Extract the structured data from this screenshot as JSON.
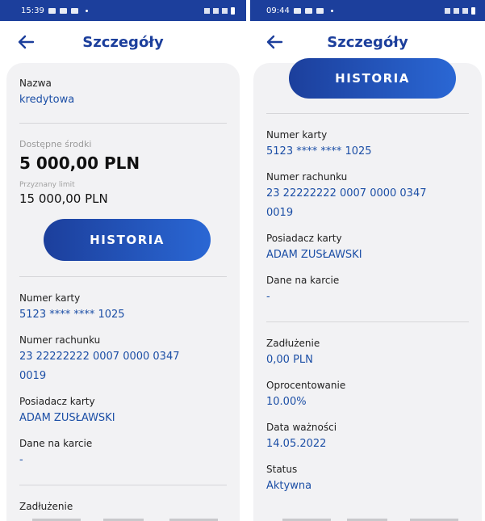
{
  "left": {
    "status": {
      "time": "15:39"
    },
    "header": {
      "title": "Szczegóły"
    },
    "nazwa": {
      "label": "Nazwa",
      "value": "kredytowa"
    },
    "dostepne": {
      "label": "Dostępne środki",
      "value": "5 000,00 PLN"
    },
    "limit": {
      "label": "Przyznany limit",
      "value": "15 000,00 PLN"
    },
    "historia_label": "HISTORIA",
    "numer_karty": {
      "label": "Numer karty",
      "value": "5123 **** **** 1025"
    },
    "numer_rachunku": {
      "label": "Numer rachunku",
      "value_line1": "23 22222222 0007 0000 0347",
      "value_line2": "0019"
    },
    "posiadacz": {
      "label": "Posiadacz karty",
      "value": "ADAM ZUSŁAWSKI"
    },
    "dane": {
      "label": "Dane na karcie",
      "value": "-"
    },
    "zadluzenie": {
      "label": "Zadłużenie"
    }
  },
  "right": {
    "status": {
      "time": "09:44"
    },
    "header": {
      "title": "Szczegóły"
    },
    "historia_label": "HISTORIA",
    "numer_karty": {
      "label": "Numer karty",
      "value": "5123 **** **** 1025"
    },
    "numer_rachunku": {
      "label": "Numer rachunku",
      "value_line1": "23 22222222 0007 0000 0347",
      "value_line2": "0019"
    },
    "posiadacz": {
      "label": "Posiadacz karty",
      "value": "ADAM ZUSŁAWSKI"
    },
    "dane": {
      "label": "Dane na karcie",
      "value": "-"
    },
    "zadluzenie": {
      "label": "Zadłużenie",
      "value": "0,00 PLN"
    },
    "oprocentowanie": {
      "label": "Oprocentowanie",
      "value": "10.00%"
    },
    "data_waznosci": {
      "label": "Data ważności",
      "value": "14.05.2022"
    },
    "status_field": {
      "label": "Status",
      "value": "Aktywna"
    }
  },
  "colors": {
    "primary": "#1c3f9c",
    "accent": "#2a67d4",
    "link_value": "#1c4fa6",
    "card_bg": "#f2f2f4"
  },
  "icons": {
    "back": "arrow-left-icon"
  }
}
